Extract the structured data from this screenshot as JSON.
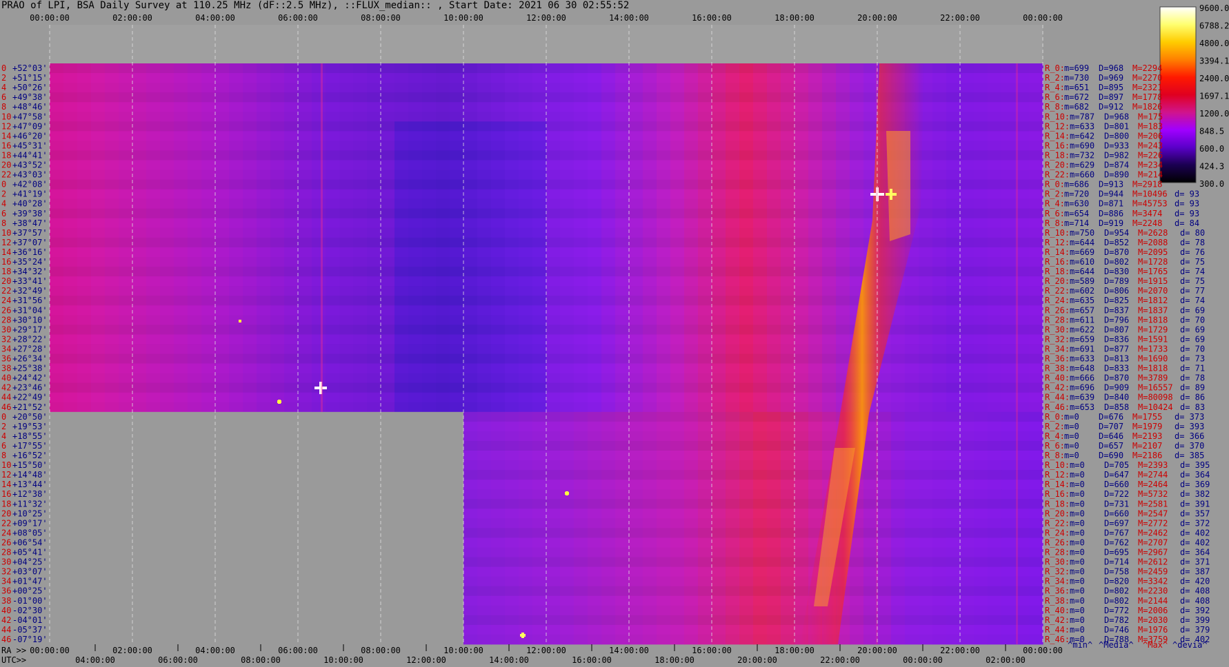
{
  "chart_data": {
    "type": "heatmap",
    "title": "PRAO of LPI, BSA Daily Survey at 110.25 MHz (dF::2.5 MHz), ::FLUX_median:: , Start Date: 2021 06 30 02:55:52",
    "top_time_ticks": [
      "00:00:00",
      "02:00:00",
      "04:00:00",
      "06:00:00",
      "08:00:00",
      "10:00:00",
      "12:00:00",
      "14:00:00",
      "16:00:00",
      "18:00:00",
      "20:00:00",
      "22:00:00",
      "00:00:00"
    ],
    "ra_prefix": "RA >>",
    "ra_ticks": [
      "00:00:00",
      "02:00:00",
      "04:00:00",
      "06:00:00",
      "08:00:00",
      "10:00:00",
      "12:00:00",
      "14:00:00",
      "16:00:00",
      "18:00:00",
      "20:00:00",
      "22:00:00",
      "00:00:00"
    ],
    "utc_prefix": "UTC>>",
    "utc_ticks": [
      "04:00:00",
      "06:00:00",
      "08:00:00",
      "10:00:00",
      "12:00:00",
      "14:00:00",
      "16:00:00",
      "18:00:00",
      "20:00:00",
      "22:00:00",
      "00:00:00",
      "02:00:00"
    ],
    "colorbar": {
      "labels": [
        "9600.0",
        "6788.2",
        "4800.0",
        "3394.1",
        "2400.0",
        "1697.1",
        "1200.0",
        "848.5",
        "600.0",
        "424.3",
        "300.0"
      ],
      "colors": [
        "#ffffff",
        "#ffff70",
        "#ffcc00",
        "#ff8000",
        "#ff1a00",
        "#e00020",
        "#d0148c",
        "#a000ff",
        "#5a00c8",
        "#1a0050",
        "#000000"
      ]
    },
    "declinations": [
      "+52°03'",
      "+51°15'",
      "+50°26'",
      "+49°38'",
      "+48°46'",
      "+47°58'",
      "+47°09'",
      "+46°20'",
      "+45°31'",
      "+44°41'",
      "+43°52'",
      "+43°03'",
      "+42°08'",
      "+41°19'",
      "+40°28'",
      "+39°38'",
      "+38°47'",
      "+37°57'",
      "+37°07'",
      "+36°16'",
      "+35°24'",
      "+34°32'",
      "+33°41'",
      "+32°49'",
      "+31°56'",
      "+31°04'",
      "+30°10'",
      "+29°17'",
      "+28°22'",
      "+27°28'",
      "+26°34'",
      "+25°38'",
      "+24°42'",
      "+23°46'",
      "+22°49'",
      "+21°52'",
      "+20°50'",
      "+19°53'",
      "+18°55'",
      "+17°55'",
      "+16°52'",
      "+15°50'",
      "+14°48'",
      "+13°44'",
      "+12°38'",
      "+11°32'",
      "+10°25'",
      "+09°17'",
      "+08°05'",
      "+06°54'",
      "+05°41'",
      "+04°25'",
      "+03°07'",
      "+01°47'",
      "+00°25'",
      "-01°00'",
      "-02°30'",
      "-04°01'",
      "-05°37'",
      "-07°19'"
    ],
    "beam_index_labels": [
      "0",
      "2",
      "4",
      "6",
      "8",
      "10",
      "12",
      "14",
      "16",
      "18",
      "20",
      "22",
      "0",
      "2",
      "4",
      "6",
      "8",
      "10",
      "12",
      "14",
      "16",
      "18",
      "20",
      "22",
      "24",
      "26",
      "28",
      "30",
      "32",
      "34",
      "36",
      "38",
      "40",
      "42",
      "44",
      "46",
      "0",
      "2",
      "4",
      "6",
      "8",
      "10",
      "12",
      "14",
      "16",
      "18",
      "20",
      "22",
      "24",
      "26",
      "28",
      "30",
      "32",
      "34",
      "36",
      "38",
      "40",
      "42",
      "44",
      "46"
    ],
    "stats_rows": [
      {
        "r": "R_0:",
        "m": "m=699",
        "D": "D=968",
        "M": "M=2294",
        "d": ""
      },
      {
        "r": "R_2:",
        "m": "m=730",
        "D": "D=969",
        "M": "M=2270",
        "d": ""
      },
      {
        "r": "R_4:",
        "m": "m=651",
        "D": "D=895",
        "M": "M=2321",
        "d": ""
      },
      {
        "r": "R_6:",
        "m": "m=672",
        "D": "D=897",
        "M": "M=1778",
        "d": ""
      },
      {
        "r": "R_8:",
        "m": "m=682",
        "D": "D=912",
        "M": "M=1826",
        "d": ""
      },
      {
        "r": "R_10:",
        "m": "m=787",
        "D": "D=968",
        "M": "M=175",
        "d": ""
      },
      {
        "r": "R_12:",
        "m": "m=633",
        "D": "D=801",
        "M": "M=183",
        "d": ""
      },
      {
        "r": "R_14:",
        "m": "m=642",
        "D": "D=800",
        "M": "M=206",
        "d": ""
      },
      {
        "r": "R_16:",
        "m": "m=690",
        "D": "D=933",
        "M": "M=243",
        "d": ""
      },
      {
        "r": "R_18:",
        "m": "m=732",
        "D": "D=982",
        "M": "M=226",
        "d": ""
      },
      {
        "r": "R_20:",
        "m": "m=629",
        "D": "D=874",
        "M": "M=234",
        "d": ""
      },
      {
        "r": "R_22:",
        "m": "m=660",
        "D": "D=890",
        "M": "M=214",
        "d": ""
      },
      {
        "r": "R_0:",
        "m": "m=686",
        "D": "D=913",
        "M": "M=2918",
        "d": ""
      },
      {
        "r": "R_2:",
        "m": "m=720",
        "D": "D=944",
        "M": "M=10496",
        "d": "d= 93"
      },
      {
        "r": "R_4:",
        "m": "m=630",
        "D": "D=871",
        "M": "M=45753",
        "d": "d= 93"
      },
      {
        "r": "R_6:",
        "m": "m=654",
        "D": "D=886",
        "M": "M=3474",
        "d": "d= 93"
      },
      {
        "r": "R_8:",
        "m": "m=714",
        "D": "D=919",
        "M": "M=2248",
        "d": "d= 84"
      },
      {
        "r": "R_10:",
        "m": "m=750",
        "D": "D=954",
        "M": "M=2628",
        "d": "d= 80"
      },
      {
        "r": "R_12:",
        "m": "m=644",
        "D": "D=852",
        "M": "M=2088",
        "d": "d= 78"
      },
      {
        "r": "R_14:",
        "m": "m=669",
        "D": "D=870",
        "M": "M=2095",
        "d": "d= 76"
      },
      {
        "r": "R_16:",
        "m": "m=610",
        "D": "D=802",
        "M": "M=1728",
        "d": "d= 75"
      },
      {
        "r": "R_18:",
        "m": "m=644",
        "D": "D=830",
        "M": "M=1765",
        "d": "d= 74"
      },
      {
        "r": "R_20:",
        "m": "m=589",
        "D": "D=789",
        "M": "M=1915",
        "d": "d= 75"
      },
      {
        "r": "R_22:",
        "m": "m=602",
        "D": "D=806",
        "M": "M=2070",
        "d": "d= 77"
      },
      {
        "r": "R_24:",
        "m": "m=635",
        "D": "D=825",
        "M": "M=1812",
        "d": "d= 74"
      },
      {
        "r": "R_26:",
        "m": "m=657",
        "D": "D=837",
        "M": "M=1837",
        "d": "d= 69"
      },
      {
        "r": "R_28:",
        "m": "m=611",
        "D": "D=796",
        "M": "M=1818",
        "d": "d= 70"
      },
      {
        "r": "R_30:",
        "m": "m=622",
        "D": "D=807",
        "M": "M=1729",
        "d": "d= 69"
      },
      {
        "r": "R_32:",
        "m": "m=659",
        "D": "D=836",
        "M": "M=1591",
        "d": "d= 69"
      },
      {
        "r": "R_34:",
        "m": "m=691",
        "D": "D=877",
        "M": "M=1733",
        "d": "d= 70"
      },
      {
        "r": "R_36:",
        "m": "m=633",
        "D": "D=813",
        "M": "M=1690",
        "d": "d= 73"
      },
      {
        "r": "R_38:",
        "m": "m=648",
        "D": "D=833",
        "M": "M=1818",
        "d": "d= 71"
      },
      {
        "r": "R_40:",
        "m": "m=666",
        "D": "D=870",
        "M": "M=3789",
        "d": "d= 78"
      },
      {
        "r": "R_42:",
        "m": "m=696",
        "D": "D=909",
        "M": "M=16557",
        "d": "d= 89"
      },
      {
        "r": "R_44:",
        "m": "m=639",
        "D": "D=840",
        "M": "M=80098",
        "d": "d= 86"
      },
      {
        "r": "R_46:",
        "m": "m=653",
        "D": "D=858",
        "M": "M=10424",
        "d": "d= 83"
      },
      {
        "r": "R_0:",
        "m": "m=0",
        "D": "D=676",
        "M": "M=1755",
        "d": "d= 373"
      },
      {
        "r": "R_2:",
        "m": "m=0",
        "D": "D=707",
        "M": "M=1979",
        "d": "d= 393"
      },
      {
        "r": "R_4:",
        "m": "m=0",
        "D": "D=646",
        "M": "M=2193",
        "d": "d= 366"
      },
      {
        "r": "R_6:",
        "m": "m=0",
        "D": "D=657",
        "M": "M=2107",
        "d": "d= 370"
      },
      {
        "r": "R_8:",
        "m": "m=0",
        "D": "D=690",
        "M": "M=2186",
        "d": "d= 385"
      },
      {
        "r": "R_10:",
        "m": "m=0",
        "D": "D=705",
        "M": "M=2393",
        "d": "d= 395"
      },
      {
        "r": "R_12:",
        "m": "m=0",
        "D": "D=647",
        "M": "M=2744",
        "d": "d= 364"
      },
      {
        "r": "R_14:",
        "m": "m=0",
        "D": "D=660",
        "M": "M=2464",
        "d": "d= 369"
      },
      {
        "r": "R_16:",
        "m": "m=0",
        "D": "D=722",
        "M": "M=5732",
        "d": "d= 382"
      },
      {
        "r": "R_18:",
        "m": "m=0",
        "D": "D=731",
        "M": "M=2581",
        "d": "d= 391"
      },
      {
        "r": "R_20:",
        "m": "m=0",
        "D": "D=660",
        "M": "M=2547",
        "d": "d= 357"
      },
      {
        "r": "R_22:",
        "m": "m=0",
        "D": "D=697",
        "M": "M=2772",
        "d": "d= 372"
      },
      {
        "r": "R_24:",
        "m": "m=0",
        "D": "D=767",
        "M": "M=2462",
        "d": "d= 402"
      },
      {
        "r": "R_26:",
        "m": "m=0",
        "D": "D=762",
        "M": "M=2707",
        "d": "d= 402"
      },
      {
        "r": "R_28:",
        "m": "m=0",
        "D": "D=695",
        "M": "M=2967",
        "d": "d= 364"
      },
      {
        "r": "R_30:",
        "m": "m=0",
        "D": "D=714",
        "M": "M=2612",
        "d": "d= 371"
      },
      {
        "r": "R_32:",
        "m": "m=0",
        "D": "D=758",
        "M": "M=2459",
        "d": "d= 387"
      },
      {
        "r": "R_34:",
        "m": "m=0",
        "D": "D=820",
        "M": "M=3342",
        "d": "d= 420"
      },
      {
        "r": "R_36:",
        "m": "m=0",
        "D": "D=802",
        "M": "M=2230",
        "d": "d= 408"
      },
      {
        "r": "R_38:",
        "m": "m=0",
        "D": "D=802",
        "M": "M=2144",
        "d": "d= 408"
      },
      {
        "r": "R_40:",
        "m": "m=0",
        "D": "D=772",
        "M": "M=2006",
        "d": "d= 392"
      },
      {
        "r": "R_42:",
        "m": "m=0",
        "D": "D=782",
        "M": "M=2030",
        "d": "d= 399"
      },
      {
        "r": "R_44:",
        "m": "m=0",
        "D": "D=746",
        "M": "M=1976",
        "d": "d= 379"
      },
      {
        "r": "R_46:",
        "m": "m=0",
        "D": "D=788",
        "M": "M=3759",
        "d": "d= 402"
      }
    ],
    "legend": [
      "^min^",
      "^Media^",
      "^Max^",
      "^devia^"
    ]
  }
}
